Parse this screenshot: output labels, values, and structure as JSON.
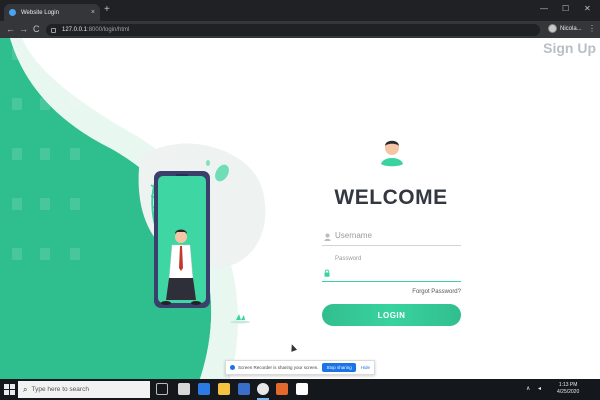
{
  "browser": {
    "tab_title": "Website Login",
    "tab_close": "×",
    "new_tab": "+",
    "url_host": "127.0.0.1",
    "url_path": ":8000/login/html",
    "profile_name": "Nicola...",
    "window_minimize": "—",
    "window_maximize": "☐",
    "window_close": "✕",
    "back": "←",
    "forward": "→",
    "reload": "C",
    "menu": "⋮"
  },
  "page": {
    "signup_label": "Sign Up",
    "welcome_heading": "WELCOME",
    "username_placeholder": "Username",
    "password_label": "Password",
    "forgot_password": "Forgot Password?",
    "login_button": "LOGIN"
  },
  "share_notice": {
    "message": "Screen Recorder is sharing your screen.",
    "stop_label": "Stop sharing",
    "hide_label": "Hide"
  },
  "taskbar": {
    "search_placeholder": "Type here to search",
    "time": "1:13 PM",
    "date": "4/25/2020"
  },
  "icons": [
    "search-icon",
    "task-view-icon",
    "edge-icon",
    "file-explorer-icon",
    "store-icon",
    "mail-icon",
    "chrome-icon",
    "media-icon",
    "app-icon",
    "user-icon",
    "lock-icon"
  ],
  "colors": {
    "accent_green": "#38d39f",
    "dark_green": "#32be8f",
    "heading_text": "#333840",
    "browser_dark": "#202124",
    "taskbar": "#14171c"
  }
}
